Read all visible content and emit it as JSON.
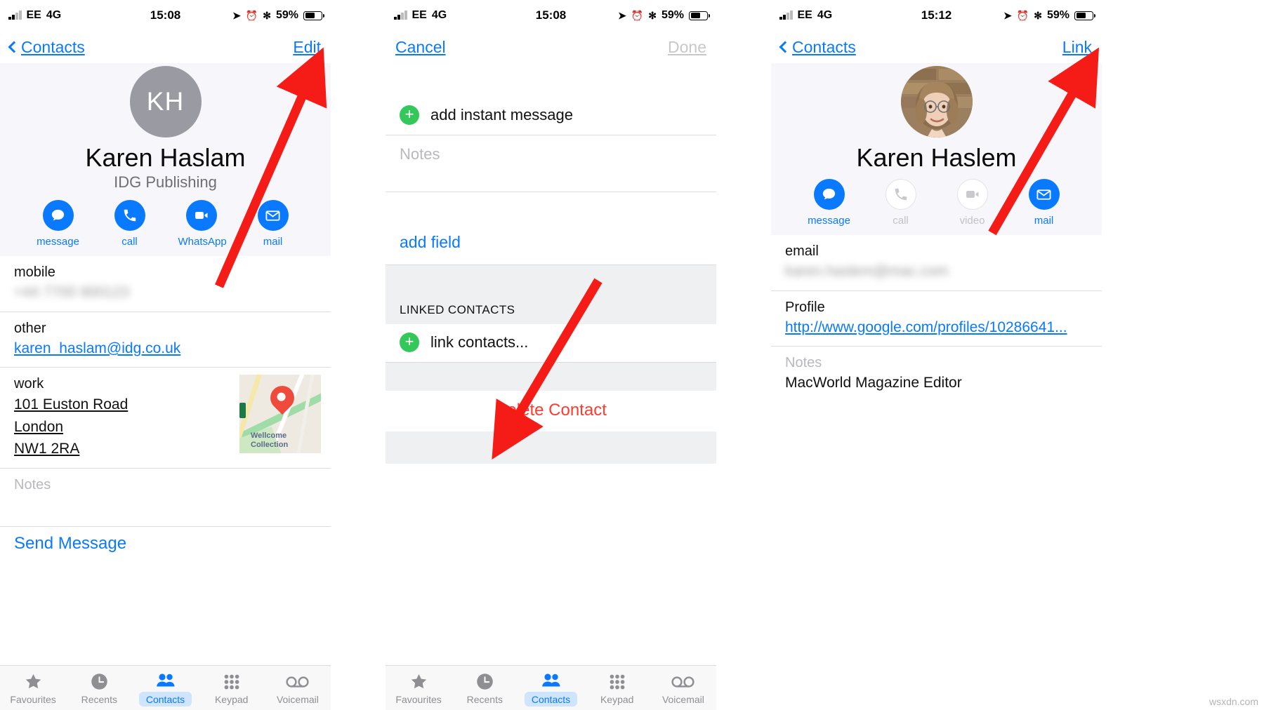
{
  "panels": [
    {
      "id": "contact-view",
      "status": {
        "carrier": "EE",
        "network": "4G",
        "time": "15:08",
        "battery_pct": "59%"
      },
      "nav": {
        "back_label": "Contacts",
        "right_label": "Edit"
      },
      "contact": {
        "initials": "KH",
        "name": "Karen Haslam",
        "org": "IDG Publishing",
        "actions": [
          {
            "label": "message",
            "icon": "message-bubble-icon",
            "enabled": true
          },
          {
            "label": "call",
            "icon": "phone-icon",
            "enabled": true
          },
          {
            "label": "WhatsApp",
            "icon": "video-camera-icon",
            "enabled": true
          },
          {
            "label": "mail",
            "icon": "envelope-icon",
            "enabled": true
          }
        ]
      },
      "fields": [
        {
          "label": "mobile",
          "value": "",
          "kind": "blurred"
        },
        {
          "label": "other",
          "value": "karen_haslam@idg.co.uk",
          "kind": "link"
        },
        {
          "label": "work",
          "lines": [
            "101 Euston Road",
            "London",
            "NW1 2RA"
          ],
          "kind": "address",
          "map_label": "Wellcome Collection"
        },
        {
          "label": "Notes",
          "value": "",
          "kind": "placeholder"
        }
      ],
      "send_message": "Send Message"
    },
    {
      "id": "edit-view",
      "status": {
        "carrier": "EE",
        "network": "4G",
        "time": "15:08",
        "battery_pct": "59%"
      },
      "nav": {
        "left_label": "Cancel",
        "right_label": "Done",
        "right_disabled": true
      },
      "rows": {
        "add_instant_message": "add instant message",
        "notes_placeholder": "Notes",
        "add_field": "add field",
        "linked_contacts_header": "LINKED CONTACTS",
        "link_contacts": "link contacts...",
        "delete_contact": "Delete Contact"
      }
    },
    {
      "id": "linked-contact-view",
      "status": {
        "carrier": "EE",
        "network": "4G",
        "time": "15:12",
        "battery_pct": "59%"
      },
      "nav": {
        "back_label": "Contacts",
        "right_label": "Link"
      },
      "contact": {
        "name": "Karen Haslem",
        "avatar": "photo-avatar",
        "actions": [
          {
            "label": "message",
            "icon": "message-bubble-icon",
            "enabled": true
          },
          {
            "label": "call",
            "icon": "phone-icon",
            "enabled": false
          },
          {
            "label": "video",
            "icon": "video-camera-icon",
            "enabled": false
          },
          {
            "label": "mail",
            "icon": "envelope-icon",
            "enabled": true
          }
        ]
      },
      "fields": [
        {
          "label": "email",
          "value": "",
          "kind": "blurred"
        },
        {
          "label": "Profile",
          "value": "http://www.google.com/profiles/10286641...",
          "kind": "link"
        },
        {
          "label": "Notes",
          "value": "MacWorld Magazine Editor",
          "kind": "value"
        }
      ]
    }
  ],
  "tabbar": {
    "items": [
      {
        "label": "Favourites",
        "icon": "star-icon",
        "active": false
      },
      {
        "label": "Recents",
        "icon": "clock-icon",
        "active": false
      },
      {
        "label": "Contacts",
        "icon": "people-icon",
        "active": true
      },
      {
        "label": "Keypad",
        "icon": "keypad-dots-icon",
        "active": false
      },
      {
        "label": "Voicemail",
        "icon": "voicemail-icon",
        "active": false
      }
    ]
  },
  "annotations": {
    "arrow_color": "#f51b16",
    "count": 3
  },
  "watermark": "wsxdn.com"
}
